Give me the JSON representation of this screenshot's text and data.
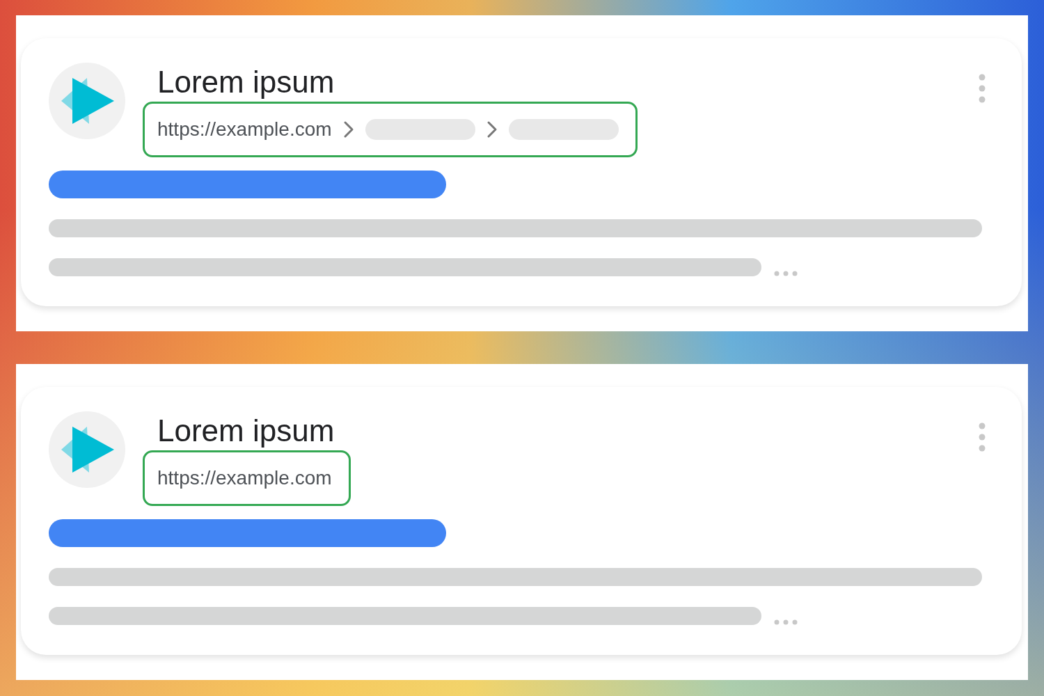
{
  "cards": [
    {
      "title": "Lorem ipsum",
      "url": "https://example.com",
      "breadcrumb": [
        {
          "kind": "placeholder"
        },
        {
          "kind": "placeholder"
        }
      ]
    },
    {
      "title": "Lorem ipsum",
      "url": "https://example.com"
    }
  ]
}
